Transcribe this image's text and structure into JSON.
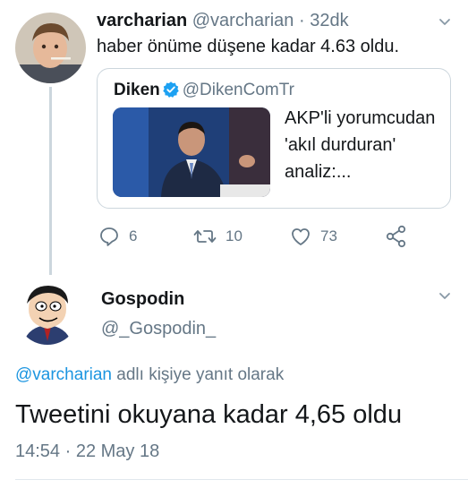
{
  "tweet1": {
    "name": "varcharian",
    "handle": "@varcharian",
    "separator": "·",
    "time": "32dk",
    "text": "haber önüme düşene kadar 4.63 oldu.",
    "quote": {
      "name": "Diken",
      "handle": "@DikenComTr",
      "text": "AKP'li yorumcudan 'akıl durduran' analiz:..."
    },
    "actions": {
      "replies": "6",
      "retweets": "10",
      "likes": "73"
    }
  },
  "tweet2": {
    "name": "Gospodin",
    "handle": "@_Gospodin_",
    "reply_to_user": "@varcharian",
    "reply_to_suffix": "adlı kişiye yanıt olarak",
    "text": "Tweetini okuyana kadar 4,65 oldu",
    "timestamp": "14:54 · 22 May 18"
  },
  "colors": {
    "link": "#1b95e0",
    "muted": "#657786",
    "border": "#ccd6dd",
    "text": "#14171a"
  },
  "icons": [
    "reply-icon",
    "retweet-icon",
    "like-icon",
    "share-icon",
    "verified-badge-icon",
    "chevron-down-icon"
  ]
}
